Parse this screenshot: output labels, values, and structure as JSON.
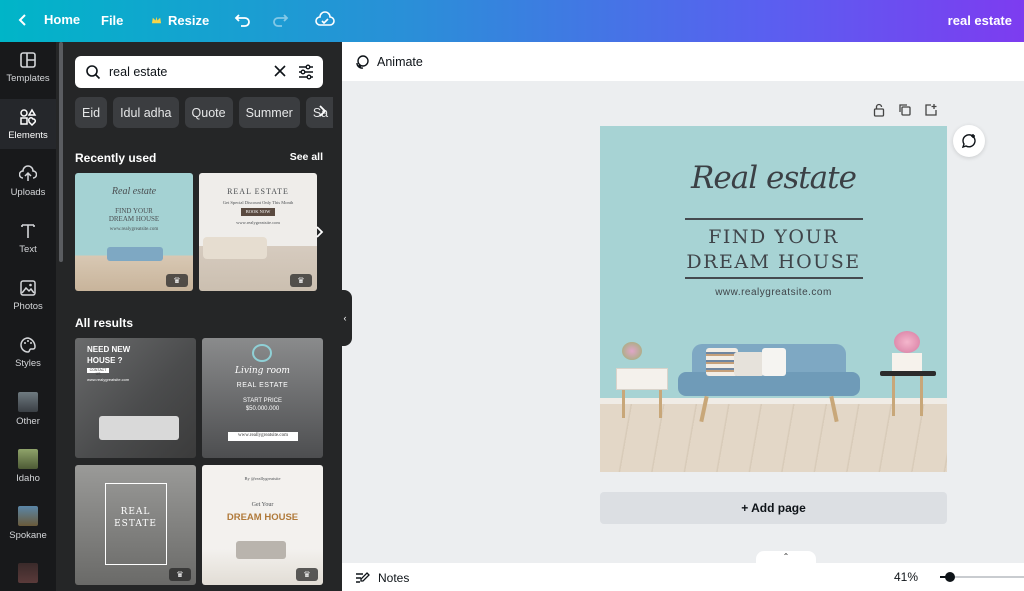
{
  "topbar": {
    "home_label": "Home",
    "file_label": "File",
    "resize_label": "Resize",
    "title": "real estate"
  },
  "rail": {
    "items": [
      {
        "label": "Templates",
        "icon": "templates-icon"
      },
      {
        "label": "Elements",
        "icon": "elements-icon"
      },
      {
        "label": "Uploads",
        "icon": "upload-cloud-icon"
      },
      {
        "label": "Text",
        "icon": "text-icon"
      },
      {
        "label": "Photos",
        "icon": "photos-icon"
      },
      {
        "label": "Styles",
        "icon": "palette-icon"
      },
      {
        "label": "Other",
        "icon": "folder-thumb"
      },
      {
        "label": "Idaho",
        "icon": "folder-thumb"
      },
      {
        "label": "Spokane",
        "icon": "folder-thumb"
      }
    ]
  },
  "panel": {
    "search_value": "real estate",
    "chips": [
      "Eid",
      "Idul adha",
      "Quote",
      "Summer",
      "Sa"
    ],
    "recently_used_title": "Recently used",
    "see_all": "See all",
    "all_results_title": "All results",
    "thumbs": {
      "recent1": {
        "script": "Real estate",
        "l1": "FIND YOUR",
        "l2": "DREAM HOUSE",
        "site": "www.realygreatsite.com"
      },
      "recent2": {
        "title": "REAL ESTATE",
        "sub": "Get Special Discount Only This Month",
        "btn": "BOOK NOW",
        "site": "www.realygreatsite.com"
      },
      "result1": {
        "l1": "NEED NEW",
        "l2": "HOUSE ?",
        "btn": "CONTACT US",
        "site": "www.realygreatsite.com"
      },
      "result2": {
        "script": "Living room",
        "title": "REAL ESTATE",
        "price_label": "START PRICE",
        "price": "$50.000.000",
        "site": "www.reallygreatsite.com"
      },
      "result3": {
        "l1": "REAL",
        "l2": "ESTATE"
      },
      "result4": {
        "handle": "By @reallygreatsite",
        "l1": "Get Your",
        "l2": "DREAM HOUSE"
      }
    }
  },
  "canvas": {
    "animate_label": "Animate",
    "script_title": "Real estate",
    "line1": "FIND YOUR",
    "line2": "DREAM HOUSE",
    "website": "www.realygreatsite.com",
    "add_page": "+ Add page"
  },
  "footer": {
    "notes_label": "Notes",
    "zoom": "41%",
    "zoom_level": 0.41
  },
  "colors": {
    "design_bg": "#a7d3d4",
    "panel_bg": "#252627",
    "rail_bg": "#18191b",
    "sofa": "#7ea8c3"
  }
}
